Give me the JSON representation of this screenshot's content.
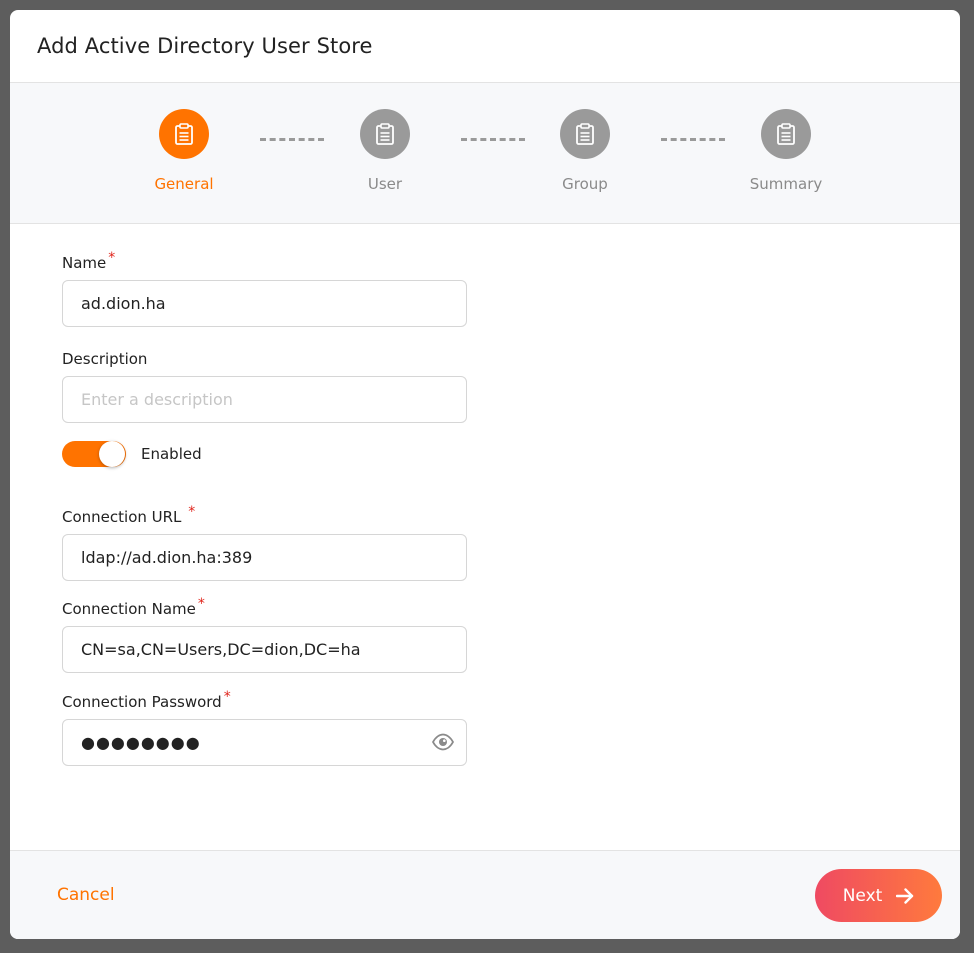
{
  "dialog": {
    "title": "Add Active Directory User Store"
  },
  "steps": [
    {
      "label": "General",
      "active": true,
      "icon": "clipboard-icon"
    },
    {
      "label": "User",
      "active": false,
      "icon": "clipboard-icon"
    },
    {
      "label": "Group",
      "active": false,
      "icon": "clipboard-icon"
    },
    {
      "label": "Summary",
      "active": false,
      "icon": "clipboard-icon"
    }
  ],
  "form": {
    "name": {
      "label": "Name",
      "required_mark": "*",
      "value": "ad.dion.ha"
    },
    "description": {
      "label": "Description",
      "value": "",
      "placeholder": "Enter a description"
    },
    "enabled": {
      "label": "Enabled",
      "on": true
    },
    "connection_url": {
      "label": "Connection URL",
      "required_mark": "*",
      "value": "ldap://ad.dion.ha:389"
    },
    "connection_name": {
      "label": "Connection Name",
      "required_mark": "*",
      "value": "CN=sa,CN=Users,DC=dion,DC=ha"
    },
    "connection_password": {
      "label": "Connection Password",
      "required_mark": "*",
      "masked_value": "●●●●●●●●",
      "icon": "eye-icon"
    }
  },
  "footer": {
    "cancel_label": "Cancel",
    "next_label": "Next",
    "next_icon": "arrow-right-icon"
  },
  "colors": {
    "accent": "#ff7300",
    "inactive_step": "#9a9a9a",
    "required": "#e0241b",
    "next_gradient_start": "#ef4a62",
    "next_gradient_end": "#ff7a3d"
  }
}
